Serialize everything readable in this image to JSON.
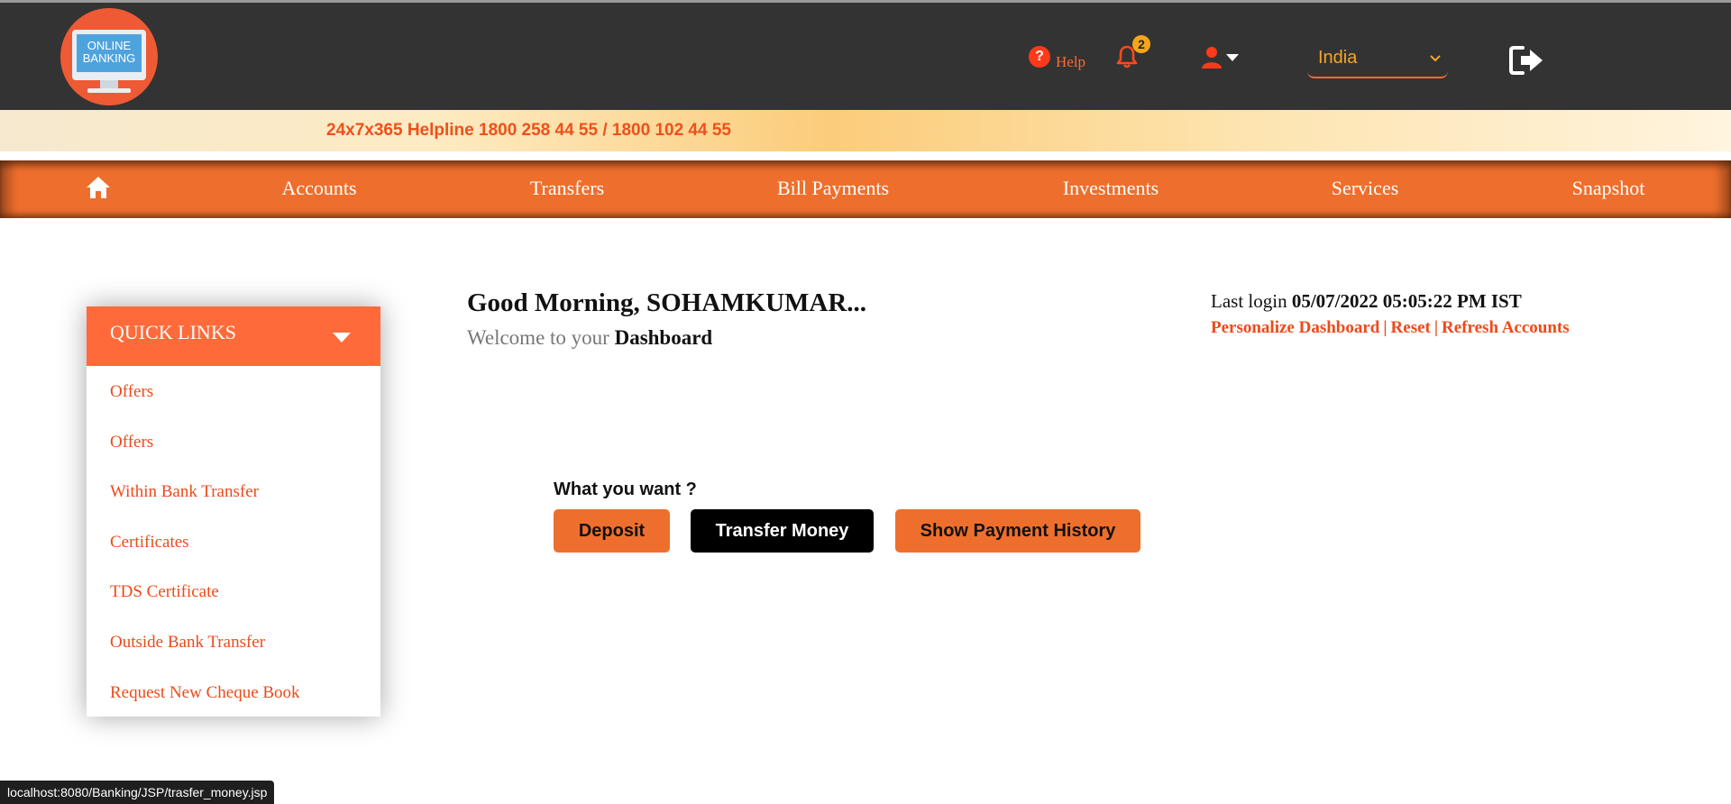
{
  "header": {
    "logo_line1": "ONLINE",
    "logo_line2": "BANKING",
    "help_label": "Help",
    "notification_count": "2",
    "country_selected": "India",
    "colors": {
      "bar": "#333333",
      "accent": "#ff6a2e",
      "country": "#f7a623"
    }
  },
  "helpline": {
    "text": "24x7x365 Helpline 1800 258 44 55 / 1800 102 44 55"
  },
  "nav": {
    "items": [
      {
        "label": "Accounts"
      },
      {
        "label": "Transfers"
      },
      {
        "label": "Bill Payments"
      },
      {
        "label": "Investments"
      },
      {
        "label": "Services"
      },
      {
        "label": "Snapshot"
      }
    ]
  },
  "quick_links": {
    "title": "QUICK LINKS",
    "items": [
      {
        "label": "Offers"
      },
      {
        "label": "Offers"
      },
      {
        "label": "Within Bank Transfer"
      },
      {
        "label": "Certificates"
      },
      {
        "label": "TDS Certificate"
      },
      {
        "label": "Outside Bank Transfer"
      },
      {
        "label": "Request New Cheque Book"
      }
    ]
  },
  "greeting": {
    "title": "Good Morning, SOHAMKUMAR...",
    "welcome_prefix": "Welcome to your",
    "welcome_strong": "Dashboard"
  },
  "login": {
    "label": "Last login",
    "value": "05/07/2022 05:05:22 PM IST",
    "links": [
      "Personalize Dashboard",
      "Reset",
      "Refresh Accounts"
    ],
    "separator": "|"
  },
  "actions": {
    "question": "What you want ?",
    "deposit": "Deposit",
    "transfer": "Transfer Money",
    "history": "Show Payment History"
  },
  "status_url": "localhost:8080/Banking/JSP/trasfer_money.jsp"
}
